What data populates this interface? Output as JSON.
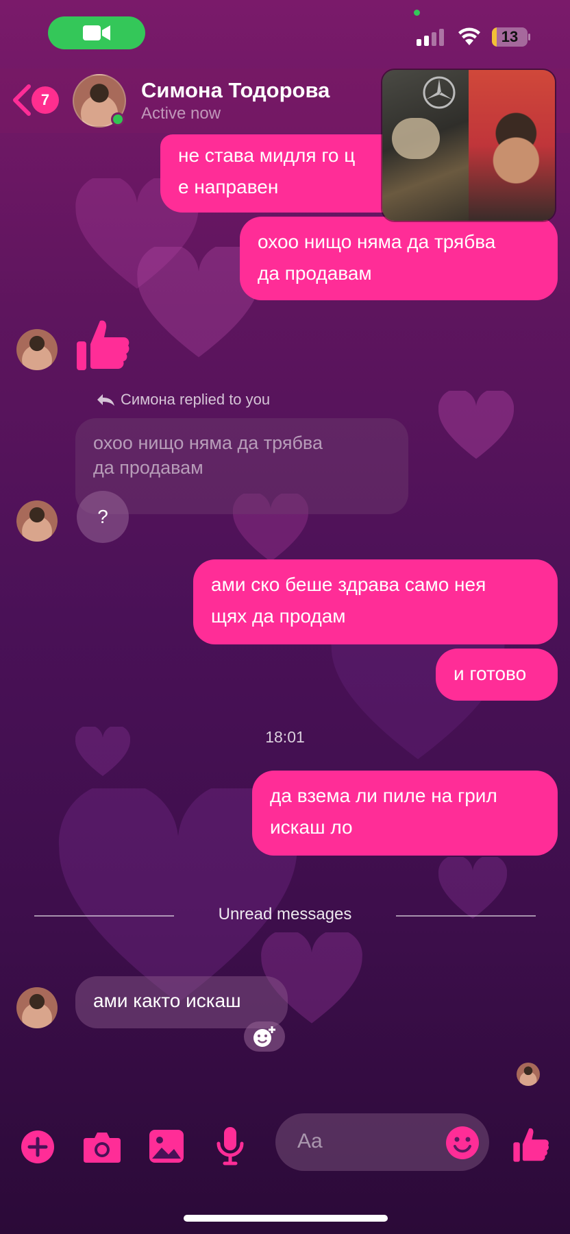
{
  "status_bar": {
    "battery_level": "13",
    "battery_fraction": 0.13,
    "call_icon": "video-camera-icon"
  },
  "header": {
    "unread_count": "7",
    "contact_name": "Симона Тодорова",
    "contact_status": "Active now"
  },
  "messages": {
    "out_1": "не става мидля го ц е направен",
    "out_1_line1": "не става мидля го ц",
    "out_1_line2": "е направен",
    "out_2_line1": "охоо нищо няма да трябва",
    "out_2_line2": "да продавам",
    "reply_label": "Симона replied to you",
    "quoted_line1": "охоо нищо няма да трябва",
    "quoted_line2": "да продавам",
    "in_question": "?",
    "out_3_line1": "ами ско беше здрава само нея",
    "out_3_line2": "щях да продам",
    "out_4": "и готово",
    "time_separator": "18:01",
    "out_5_line1": "да взема ли пиле на грил",
    "out_5_line2": "искаш ло",
    "unread_divider": "Unread messages",
    "in_last": "ами както искаш"
  },
  "composer": {
    "placeholder": "Aa",
    "icons": [
      "add-icon",
      "camera-icon",
      "image-icon",
      "microphone-icon",
      "emoji-icon",
      "thumbs-up-icon"
    ]
  },
  "theme": {
    "accent": "#ff2d97",
    "online": "#31c552",
    "call_green": "#34c759"
  }
}
